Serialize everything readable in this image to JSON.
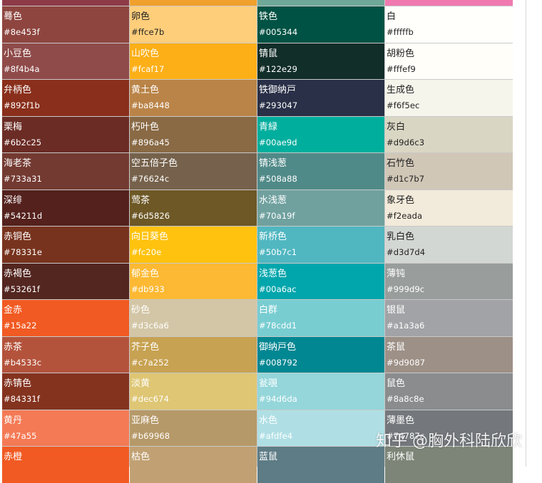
{
  "top_bar": [
    "#8e3b48",
    "#f0a02c",
    "#6fa898",
    "#f07ab0"
  ],
  "columns": [
    [
      {
        "name": "蓦色",
        "hex": "#8e453f",
        "bg": "#8e453f",
        "fg": "#ffffff"
      },
      {
        "name": "小豆色",
        "hex": "#8f4b4a",
        "bg": "#8f4b4a",
        "fg": "#ffffff"
      },
      {
        "name": "弁柄色",
        "hex": "#892f1b",
        "bg": "#892f1b",
        "fg": "#ffffff"
      },
      {
        "name": "栗梅",
        "hex": "#6b2c25",
        "bg": "#6b2c25",
        "fg": "#ffffff"
      },
      {
        "name": "海老茶",
        "hex": "#733a31",
        "bg": "#733a31",
        "fg": "#ffffff"
      },
      {
        "name": "深绯",
        "hex": "#54211d",
        "bg": "#54211d",
        "fg": "#ffffff"
      },
      {
        "name": "赤铜色",
        "hex": "#78331e",
        "bg": "#78331e",
        "fg": "#ffffff"
      },
      {
        "name": "赤褐色",
        "hex": "#53261f",
        "bg": "#53261f",
        "fg": "#ffffff"
      },
      {
        "name": "金赤",
        "hex": "#15a22",
        "bg": "#f15a22",
        "fg": "#ffffff"
      },
      {
        "name": "赤茶",
        "hex": "#b4533c",
        "bg": "#b4533c",
        "fg": "#ffffff"
      },
      {
        "name": "赤锖色",
        "hex": "#84331f",
        "bg": "#84331f",
        "fg": "#ffffff"
      },
      {
        "name": "黄丹",
        "hex": "#47a55",
        "bg": "#f47a55",
        "fg": "#ffffff"
      },
      {
        "name": "赤橙",
        "hex": "",
        "bg": "#f15a22",
        "fg": "#ffffff"
      }
    ],
    [
      {
        "name": "卵色",
        "hex": "#ffce7b",
        "bg": "#ffce7b",
        "fg": "#222222"
      },
      {
        "name": "山吹色",
        "hex": "#fcaf17",
        "bg": "#fcaf17",
        "fg": "#ffffff"
      },
      {
        "name": "黄土色",
        "hex": "#ba8448",
        "bg": "#ba8448",
        "fg": "#ffffff"
      },
      {
        "name": "朽叶色",
        "hex": "#896a45",
        "bg": "#896a45",
        "fg": "#ffffff"
      },
      {
        "name": "空五倍子色",
        "hex": "#76624c",
        "bg": "#76624c",
        "fg": "#ffffff"
      },
      {
        "name": "莺茶",
        "hex": "#6d5826",
        "bg": "#6d5826",
        "fg": "#ffffff"
      },
      {
        "name": "向日葵色",
        "hex": "#fc20e",
        "bg": "#ffc20e",
        "fg": "#ffffff"
      },
      {
        "name": "郁金色",
        "hex": "#db933",
        "bg": "#fdb933",
        "fg": "#ffffff"
      },
      {
        "name": "砂色",
        "hex": "#d3c6a6",
        "bg": "#d3c6a6",
        "fg": "#ffffff"
      },
      {
        "name": "芥子色",
        "hex": "#c7a252",
        "bg": "#c7a252",
        "fg": "#ffffff"
      },
      {
        "name": "淡黄",
        "hex": "#dec674",
        "bg": "#dec674",
        "fg": "#ffffff"
      },
      {
        "name": "亚麻色",
        "hex": "#b69968",
        "bg": "#b69968",
        "fg": "#ffffff"
      },
      {
        "name": "枯色",
        "hex": "",
        "bg": "#c1a173",
        "fg": "#ffffff"
      }
    ],
    [
      {
        "name": "铁色",
        "hex": "#005344",
        "bg": "#005344",
        "fg": "#ffffff"
      },
      {
        "name": "锖鼠",
        "hex": "#122e29",
        "bg": "#122e29",
        "fg": "#ffffff"
      },
      {
        "name": "铁御纳戸",
        "hex": "#293047",
        "bg": "#293047",
        "fg": "#ffffff"
      },
      {
        "name": "青緑",
        "hex": "#00ae9d",
        "bg": "#00ae9d",
        "fg": "#ffffff"
      },
      {
        "name": "锖浅葱",
        "hex": "#508a88",
        "bg": "#508a88",
        "fg": "#ffffff"
      },
      {
        "name": "水浅葱",
        "hex": "#70a19f",
        "bg": "#70a19f",
        "fg": "#ffffff"
      },
      {
        "name": "新桥色",
        "hex": "#50b7c1",
        "bg": "#50b7c1",
        "fg": "#ffffff"
      },
      {
        "name": "浅葱色",
        "hex": "#00a6ac",
        "bg": "#00a6ac",
        "fg": "#ffffff"
      },
      {
        "name": "白群",
        "hex": "#78cdd1",
        "bg": "#78cdd1",
        "fg": "#ffffff"
      },
      {
        "name": "御纳戸色",
        "hex": "#008792",
        "bg": "#008792",
        "fg": "#ffffff"
      },
      {
        "name": "瓮覗",
        "hex": "#94d6da",
        "bg": "#94d6da",
        "fg": "#ffffff"
      },
      {
        "name": "水色",
        "hex": "#afdfe4",
        "bg": "#afdfe4",
        "fg": "#ffffff"
      },
      {
        "name": "蓝鼠",
        "hex": "",
        "bg": "#5e7c85",
        "fg": "#ffffff"
      }
    ],
    [
      {
        "name": "白",
        "hex": "#fffffb",
        "bg": "#fffffb",
        "fg": "#222222"
      },
      {
        "name": "胡粉色",
        "hex": "#fffef9",
        "bg": "#fffef9",
        "fg": "#222222"
      },
      {
        "name": "生成色",
        "hex": "#f6f5ec",
        "bg": "#f6f5ec",
        "fg": "#222222"
      },
      {
        "name": "灰白",
        "hex": "#d9d6c3",
        "bg": "#d9d6c3",
        "fg": "#222222"
      },
      {
        "name": "石竹色",
        "hex": "#d1c7b7",
        "bg": "#d1c7b7",
        "fg": "#222222"
      },
      {
        "name": "象牙色",
        "hex": "#f2eada",
        "bg": "#f2eada",
        "fg": "#222222"
      },
      {
        "name": "乳白色",
        "hex": "#d3d7d4",
        "bg": "#d3d7d4",
        "fg": "#222222"
      },
      {
        "name": "薄钝",
        "hex": "#999d9c",
        "bg": "#999d9c",
        "fg": "#ffffff"
      },
      {
        "name": "银鼠",
        "hex": "#a1a3a6",
        "bg": "#a1a3a6",
        "fg": "#ffffff"
      },
      {
        "name": "茶鼠",
        "hex": "#9d9087",
        "bg": "#9d9087",
        "fg": "#ffffff"
      },
      {
        "name": "鼠色",
        "hex": "#8a8c8e",
        "bg": "#8a8c8e",
        "fg": "#ffffff"
      },
      {
        "name": "薄墨色",
        "hex": "#74787c",
        "bg": "#74787c",
        "fg": "#ffffff"
      },
      {
        "name": "利休鼠",
        "hex": "",
        "bg": "#7c8577",
        "fg": "#ffffff"
      }
    ]
  ],
  "watermark": "知乎 @胸外科陆欣欣"
}
